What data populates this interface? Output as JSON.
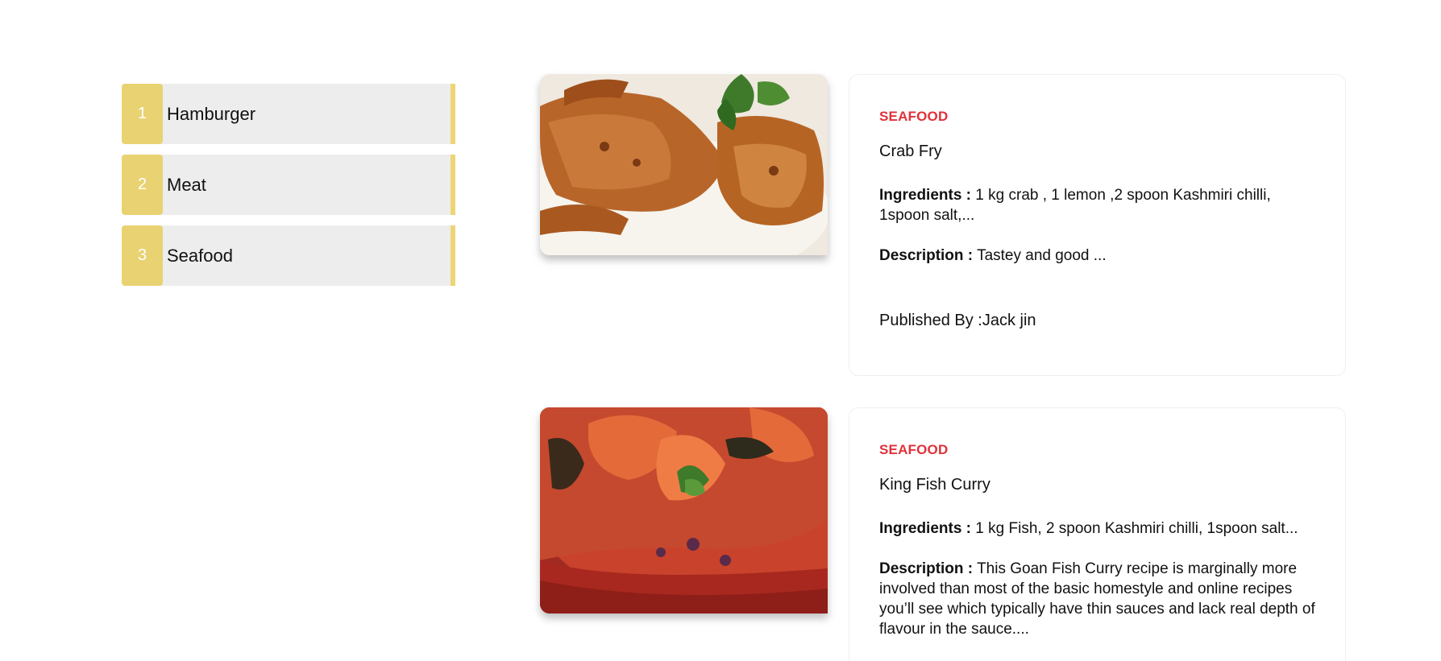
{
  "categories": [
    {
      "number": "1",
      "label": "Hamburger"
    },
    {
      "number": "2",
      "label": "Meat"
    },
    {
      "number": "3",
      "label": "Seafood"
    }
  ],
  "recipes": [
    {
      "category": "SEAFOOD",
      "title": "Crab Fry",
      "ingredients_label": "Ingredients :",
      "ingredients": "1 kg crab , 1 lemon ,2 spoon Kashmiri chilli, 1spoon salt,...",
      "description_label": "Description :",
      "description": "Tastey and good ...",
      "published_by": "Published By :Jack jin",
      "image": "crab-fry-photo"
    },
    {
      "category": "SEAFOOD",
      "title": "King Fish Curry",
      "ingredients_label": "Ingredients :",
      "ingredients": "1 kg Fish, 2 spoon Kashmiri chilli, 1spoon salt...",
      "description_label": "Description :",
      "description": "This Goan Fish Curry recipe is marginally more involved than most of the basic homestyle and online recipes you’ll see which typically have thin sauces and lack real depth of flavour in the sauce....",
      "image": "fish-curry-photo"
    }
  ],
  "colors": {
    "accent_yellow": "#e9d272",
    "category_red": "#e0313a",
    "item_bg": "#ededed"
  }
}
